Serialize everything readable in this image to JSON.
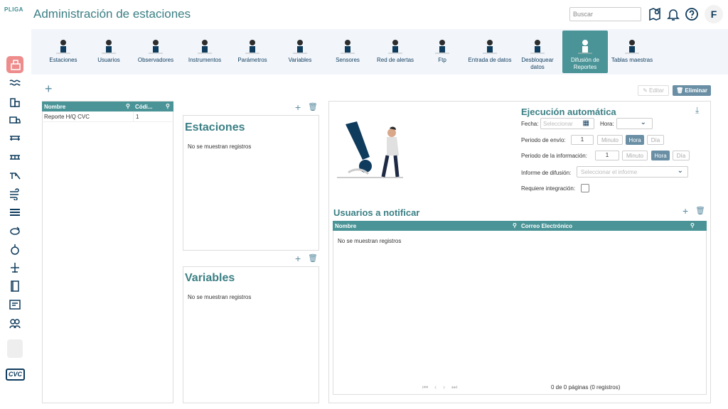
{
  "app": {
    "logo": "PLIGA",
    "title": "Administración de estaciones"
  },
  "header": {
    "search_placeholder": "Buscar",
    "avatar": "F"
  },
  "nav": [
    {
      "label": "Estaciones"
    },
    {
      "label": "Usuarios"
    },
    {
      "label": "Observadores"
    },
    {
      "label": "Instrumentos"
    },
    {
      "label": "Parámetros"
    },
    {
      "label": "Variables"
    },
    {
      "label": "Sensores"
    },
    {
      "label": "Red de alertas"
    },
    {
      "label": "Ftp"
    },
    {
      "label": "Entrada de datos"
    },
    {
      "label": "Desbloquear datos"
    },
    {
      "label": "Difusión de Reportes"
    },
    {
      "label": "Tablas maestras"
    }
  ],
  "toolbar": {
    "edit": "Editar",
    "delete": "Eliminar"
  },
  "reports_table": {
    "columns": [
      "Nombre",
      "Códi..."
    ],
    "rows": [
      [
        "Reporte H/Q CVC",
        "1"
      ]
    ]
  },
  "estaciones": {
    "title": "Estaciones",
    "empty": "No se muestran registros"
  },
  "variables": {
    "title": "Variables",
    "empty": "No se muestran registros"
  },
  "auto": {
    "title": "Ejecución automática",
    "fecha_label": "Fecha:",
    "fecha_placeholder": "Seleccionar",
    "hora_label": "Hora:",
    "envio_label": "Periodo de envío:",
    "envio_value": "1",
    "info_label": "Periodo de la información:",
    "info_value": "1",
    "unit_min": "Minuto",
    "unit_hora": "Hora",
    "unit_dia": "Día",
    "informe_label": "Informe de difusión:",
    "informe_placeholder": "Seleccionar el informe",
    "integracion_label": "Requiere integración:"
  },
  "usuarios": {
    "title": "Usuarios a notificar",
    "columns": [
      "Nombre",
      "Correo Electrónico"
    ],
    "empty": "No se muestran registros",
    "pager": "0 de 0 páginas (0 registros)"
  },
  "footer_logo": "CVC",
  "colors": {
    "teal": "#4a9497",
    "navy": "#0f3b5c",
    "active_side": "#ee8c8c"
  }
}
